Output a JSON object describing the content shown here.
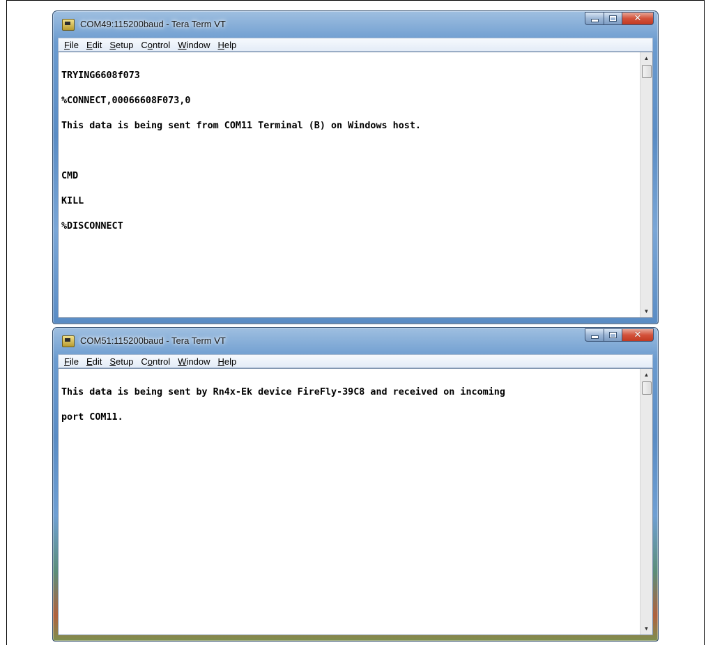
{
  "window1": {
    "title": "COM49:115200baud - Tera Term VT",
    "menu": {
      "file": "File",
      "edit": "Edit",
      "setup": "Setup",
      "control": "Control",
      "window": "Window",
      "help": "Help"
    },
    "lines": [
      "TRYING6608f073",
      "%CONNECT,00066608F073,0",
      "This data is being sent from COM11 Terminal (B) on Windows host.",
      "",
      "CMD",
      "KILL",
      "%DISCONNECT"
    ]
  },
  "window2": {
    "title": "COM51:115200baud - Tera Term VT",
    "menu": {
      "file": "File",
      "edit": "Edit",
      "setup": "Setup",
      "control": "Control",
      "window": "Window",
      "help": "Help"
    },
    "lines": [
      "This data is being sent by Rn4x-Ek device FireFly-39C8 and received on incoming",
      "port COM11."
    ]
  }
}
